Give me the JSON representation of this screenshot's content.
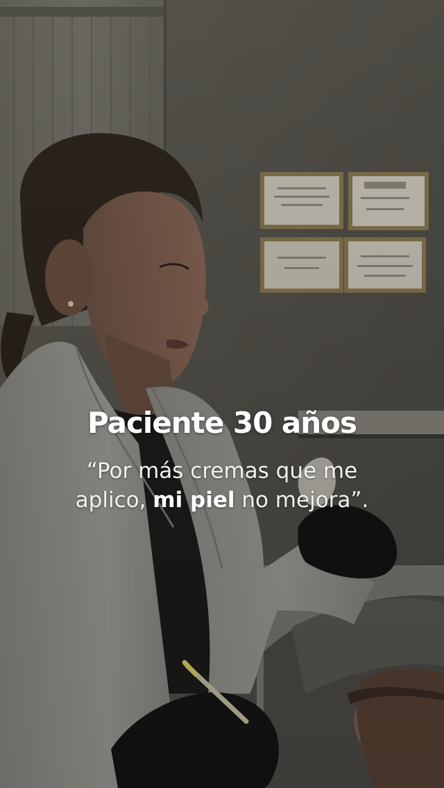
{
  "overlay": {
    "title": "Paciente 30 años",
    "quote_line1": "“Por más cremas que me",
    "quote_line2_before": "aplico, ",
    "quote_line2_emphasis": "mi piel",
    "quote_line2_after": " no mejora”."
  },
  "colors": {
    "wall": "#5a574f",
    "coat": "#9c9a94",
    "gloves": "#141414",
    "text": "#ffffff"
  }
}
